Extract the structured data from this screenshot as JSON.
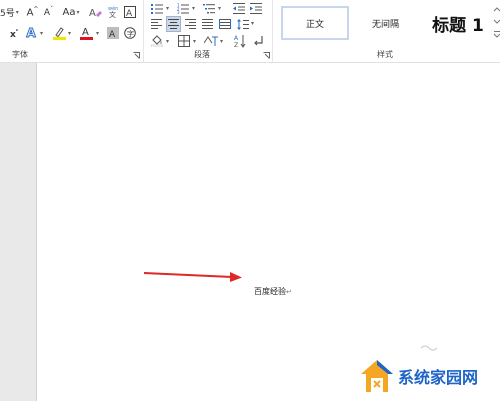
{
  "font_group": {
    "label": "字体",
    "font_size_fragment": "5号",
    "change_case": "Aa",
    "text_effect_letter": "A",
    "font_color_letter": "A",
    "shading_letter": "A",
    "highlight_color": "#f2e600",
    "font_color": "#e0141e"
  },
  "paragraph_group": {
    "label": "段落"
  },
  "styles_group": {
    "label": "样式",
    "items": [
      "正文",
      "无间隔",
      "标题 1"
    ]
  },
  "document": {
    "text": "百度经验",
    "paragraph_mark": "↵",
    "arrow_color": "#e02828"
  },
  "watermark": {
    "text": "系统家园网",
    "brand_color": "#1e64c8",
    "accent_color": "#f5a623"
  }
}
